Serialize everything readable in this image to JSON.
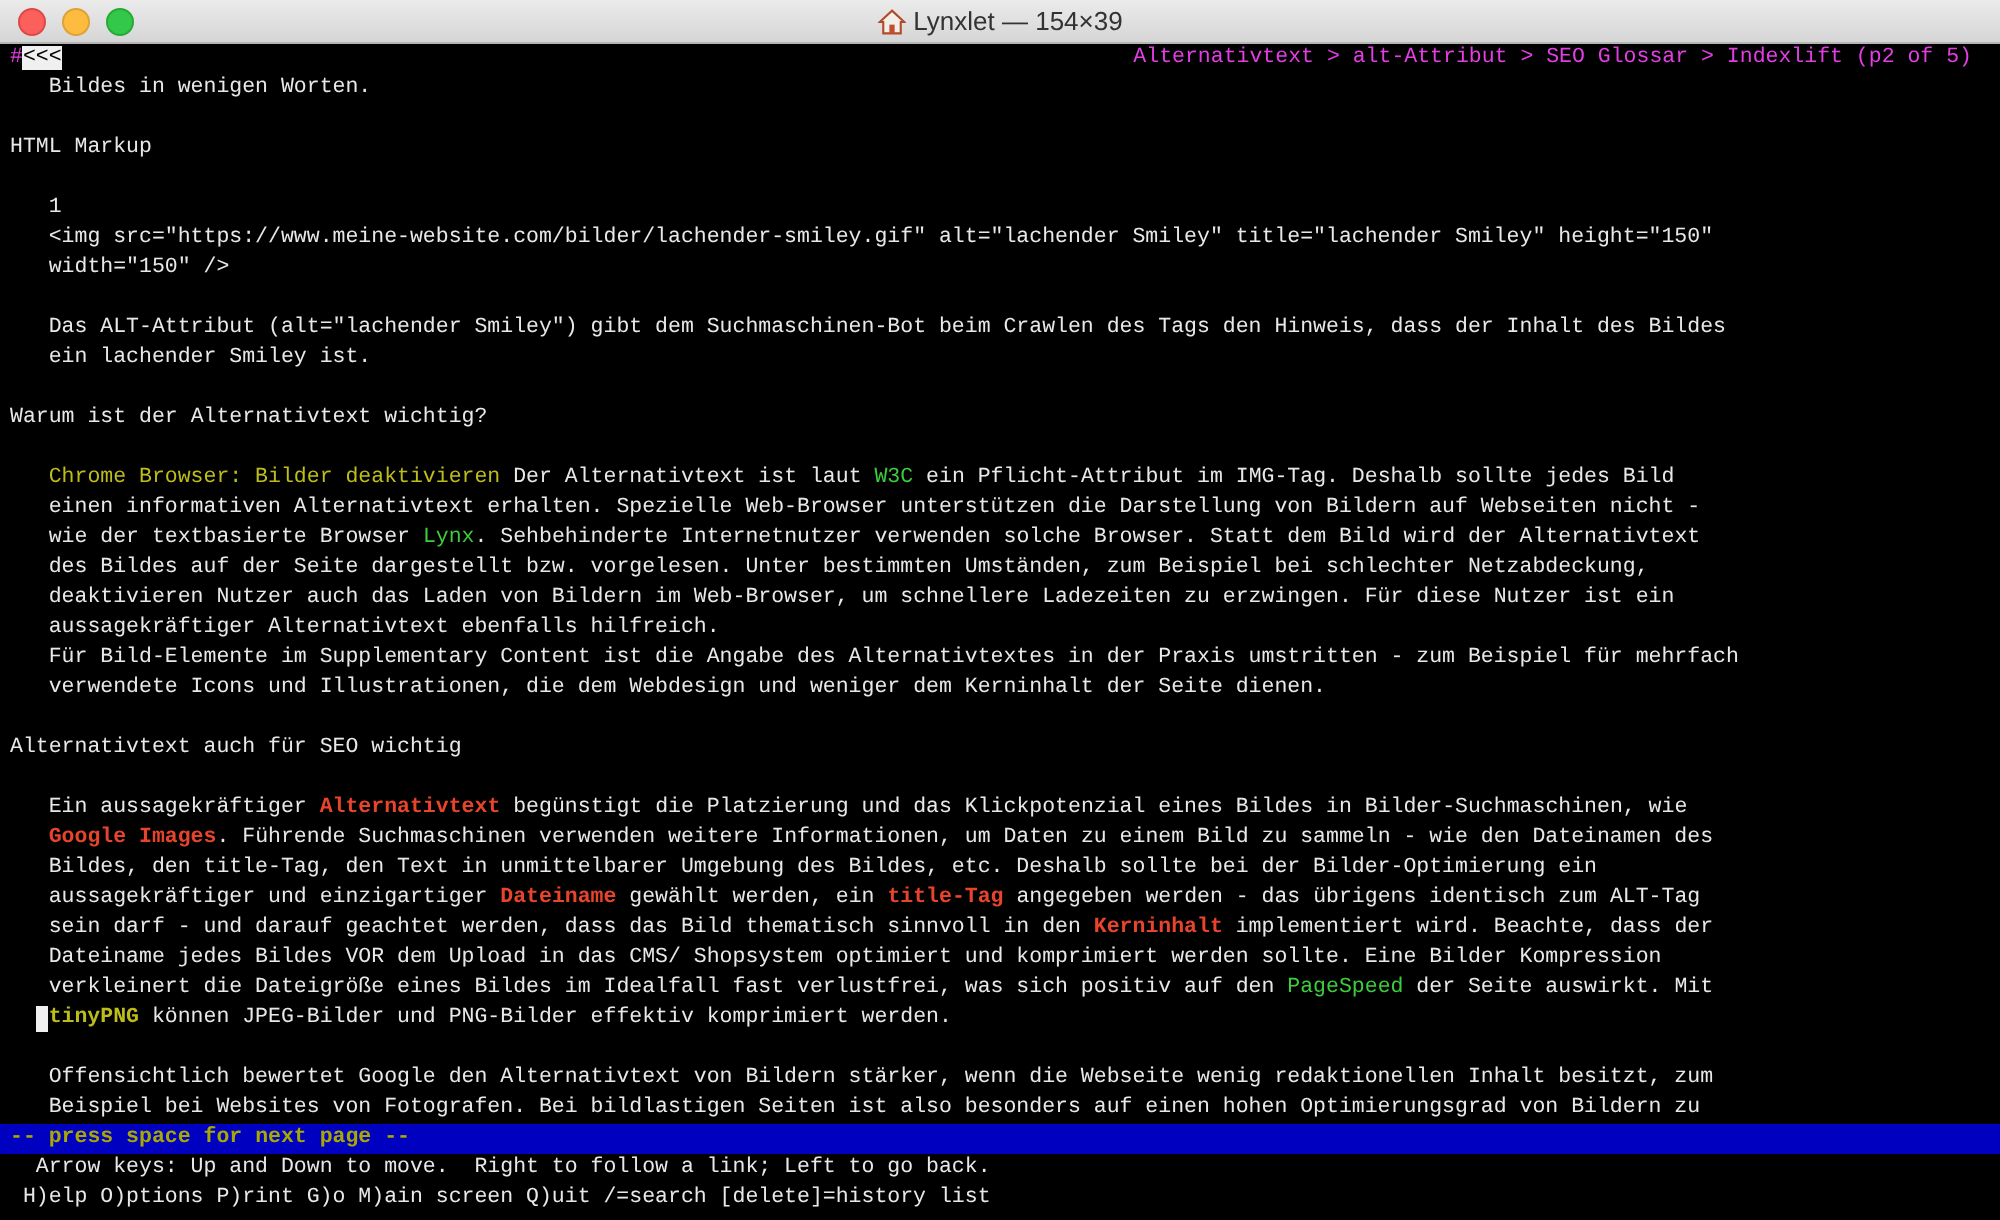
{
  "window": {
    "title": "Lynxlet — 154×39"
  },
  "top_line": {
    "marker": "#",
    "back": "<<<",
    "breadcrumb": "Alternativtext > alt-Attribut > SEO Glossar > Indexlift (p2 of 5)"
  },
  "paragraphs": [
    {
      "indented": true,
      "lines": [
        {
          "segments": [
            {
              "kind": "text",
              "text": "Bildes in wenigen Worten."
            }
          ]
        }
      ]
    },
    {
      "indented": false,
      "lines": [
        {
          "segments": [
            {
              "kind": "text",
              "text": "HTML Markup"
            }
          ]
        }
      ]
    },
    {
      "indented": true,
      "lines": [
        {
          "segments": [
            {
              "kind": "text",
              "text": "1"
            }
          ]
        },
        {
          "segments": [
            {
              "kind": "text",
              "text": "<img src=\"https://www.meine-website.com/bilder/lachender-smiley.gif\" alt=\"lachender Smiley\" title=\"lachender Smiley\" height=\"150\""
            }
          ]
        },
        {
          "segments": [
            {
              "kind": "text",
              "text": "width=\"150\" />"
            }
          ]
        }
      ]
    },
    {
      "indented": true,
      "lines": [
        {
          "segments": [
            {
              "kind": "text",
              "text": "Das ALT-Attribut (alt=\"lachender Smiley\") gibt dem Suchmaschinen-Bot beim Crawlen des Tags den Hinweis, dass der Inhalt des Bildes"
            }
          ]
        },
        {
          "segments": [
            {
              "kind": "text",
              "text": "ein lachender Smiley ist."
            }
          ]
        }
      ]
    },
    {
      "indented": false,
      "lines": [
        {
          "segments": [
            {
              "kind": "text",
              "text": "Warum ist der Alternativtext wichtig?"
            }
          ]
        }
      ]
    },
    {
      "indented": true,
      "lines": [
        {
          "segments": [
            {
              "kind": "link",
              "color": "#bdbd1a",
              "bold": false,
              "text": "Chrome Browser: Bilder deaktivieren"
            },
            {
              "kind": "text",
              "text": " Der Alternativtext ist laut "
            },
            {
              "kind": "link",
              "color": "#3ccc3c",
              "bold": false,
              "text": "W3C"
            },
            {
              "kind": "text",
              "text": " ein Pflicht-Attribut im IMG-Tag. Deshalb sollte jedes Bild"
            }
          ]
        },
        {
          "segments": [
            {
              "kind": "text",
              "text": "einen informativen Alternativtext erhalten. Spezielle Web-Browser unterstützen die Darstellung von Bildern auf Webseiten nicht -"
            }
          ]
        },
        {
          "segments": [
            {
              "kind": "text",
              "text": "wie der textbasierte Browser "
            },
            {
              "kind": "link",
              "color": "#3ccc3c",
              "bold": false,
              "text": "Lynx"
            },
            {
              "kind": "text",
              "text": ". Sehbehinderte Internetnutzer verwenden solche Browser. Statt dem Bild wird der Alternativtext"
            }
          ]
        },
        {
          "segments": [
            {
              "kind": "text",
              "text": "des Bildes auf der Seite dargestellt bzw. vorgelesen. Unter bestimmten Umständen, zum Beispiel bei schlechter Netzabdeckung,"
            }
          ]
        },
        {
          "segments": [
            {
              "kind": "text",
              "text": "deaktivieren Nutzer auch das Laden von Bildern im Web-Browser, um schnellere Ladezeiten zu erzwingen. Für diese Nutzer ist ein"
            }
          ]
        },
        {
          "segments": [
            {
              "kind": "text",
              "text": "aussagekräftiger Alternativtext ebenfalls hilfreich."
            }
          ]
        },
        {
          "segments": [
            {
              "kind": "text",
              "text": "Für Bild-Elemente im Supplementary Content ist die Angabe des Alternativtextes in der Praxis umstritten - zum Beispiel für mehrfach"
            }
          ]
        },
        {
          "segments": [
            {
              "kind": "text",
              "text": "verwendete Icons und Illustrationen, die dem Webdesign und weniger dem Kerninhalt der Seite dienen."
            }
          ]
        }
      ]
    },
    {
      "indented": false,
      "lines": [
        {
          "segments": [
            {
              "kind": "text",
              "text": "Alternativtext auch für SEO wichtig"
            }
          ]
        }
      ]
    },
    {
      "indented": true,
      "lines": [
        {
          "segments": [
            {
              "kind": "text",
              "text": "Ein aussagekräftiger "
            },
            {
              "kind": "link",
              "color": "#e8442c",
              "bold": true,
              "text": "Alternativtext"
            },
            {
              "kind": "text",
              "text": " begünstigt die Platzierung und das Klickpotenzial eines Bildes in Bilder-Suchmaschinen, wie"
            }
          ]
        },
        {
          "segments": [
            {
              "kind": "link",
              "color": "#e8442c",
              "bold": true,
              "text": "Google Images"
            },
            {
              "kind": "text",
              "text": ". Führende Suchmaschinen verwenden weitere Informationen, um Daten zu einem Bild zu sammeln - wie den Dateinamen des"
            }
          ]
        },
        {
          "segments": [
            {
              "kind": "text",
              "text": "Bildes, den title-Tag, den Text in unmittelbarer Umgebung des Bildes, etc. Deshalb sollte bei der Bilder-Optimierung ein"
            }
          ]
        },
        {
          "segments": [
            {
              "kind": "text",
              "text": "aussagekräftiger und einzigartiger "
            },
            {
              "kind": "link",
              "color": "#e8442c",
              "bold": true,
              "text": "Dateiname"
            },
            {
              "kind": "text",
              "text": " gewählt werden, ein "
            },
            {
              "kind": "link",
              "color": "#e8442c",
              "bold": true,
              "text": "title-Tag"
            },
            {
              "kind": "text",
              "text": " angegeben werden - das übrigens identisch zum ALT-Tag"
            }
          ]
        },
        {
          "segments": [
            {
              "kind": "text",
              "text": "sein darf - und darauf geachtet werden, dass das Bild thematisch sinnvoll in den "
            },
            {
              "kind": "link",
              "color": "#e8442c",
              "bold": true,
              "text": "Kerninhalt"
            },
            {
              "kind": "text",
              "text": " implementiert wird. Beachte, dass der"
            }
          ]
        },
        {
          "segments": [
            {
              "kind": "text",
              "text": "Dateiname jedes Bildes VOR dem Upload in das CMS/ Shopsystem optimiert und komprimiert werden sollte. Eine Bilder Kompression"
            }
          ]
        },
        {
          "segments": [
            {
              "kind": "text",
              "text": "verkleinert die Dateigröße eines Bildes im Idealfall fast verlustfrei, was sich positiv auf den "
            },
            {
              "kind": "link",
              "color": "#3ccc3c",
              "bold": false,
              "text": "PageSpeed"
            },
            {
              "kind": "text",
              "text": " der Seite auswirkt. Mit"
            }
          ]
        },
        {
          "cursor": true,
          "segments": [
            {
              "kind": "link",
              "color": "#bdbd1a",
              "bold": true,
              "text": "tinyPNG"
            },
            {
              "kind": "text",
              "text": " können JPEG-Bilder und PNG-Bilder effektiv komprimiert werden."
            }
          ]
        }
      ]
    },
    {
      "indented": true,
      "lines": [
        {
          "segments": [
            {
              "kind": "text",
              "text": "Offensichtlich bewertet Google den Alternativtext von Bildern stärker, wenn die Webseite wenig redaktionellen Inhalt besitzt, zum"
            }
          ]
        },
        {
          "segments": [
            {
              "kind": "text",
              "text": "Beispiel bei Websites von Fotografen. Bei bildlastigen Seiten ist also besonders auf einen hohen Optimierungsgrad von Bildern zu"
            }
          ]
        }
      ]
    }
  ],
  "status_bar": "-- press space for next page --",
  "help_lines": [
    "Arrow keys: Up and Down to move.  Right to follow a link; Left to go back.",
    "H)elp O)ptions P)rint G)o M)ain screen Q)uit /=search [delete]=history list"
  ]
}
